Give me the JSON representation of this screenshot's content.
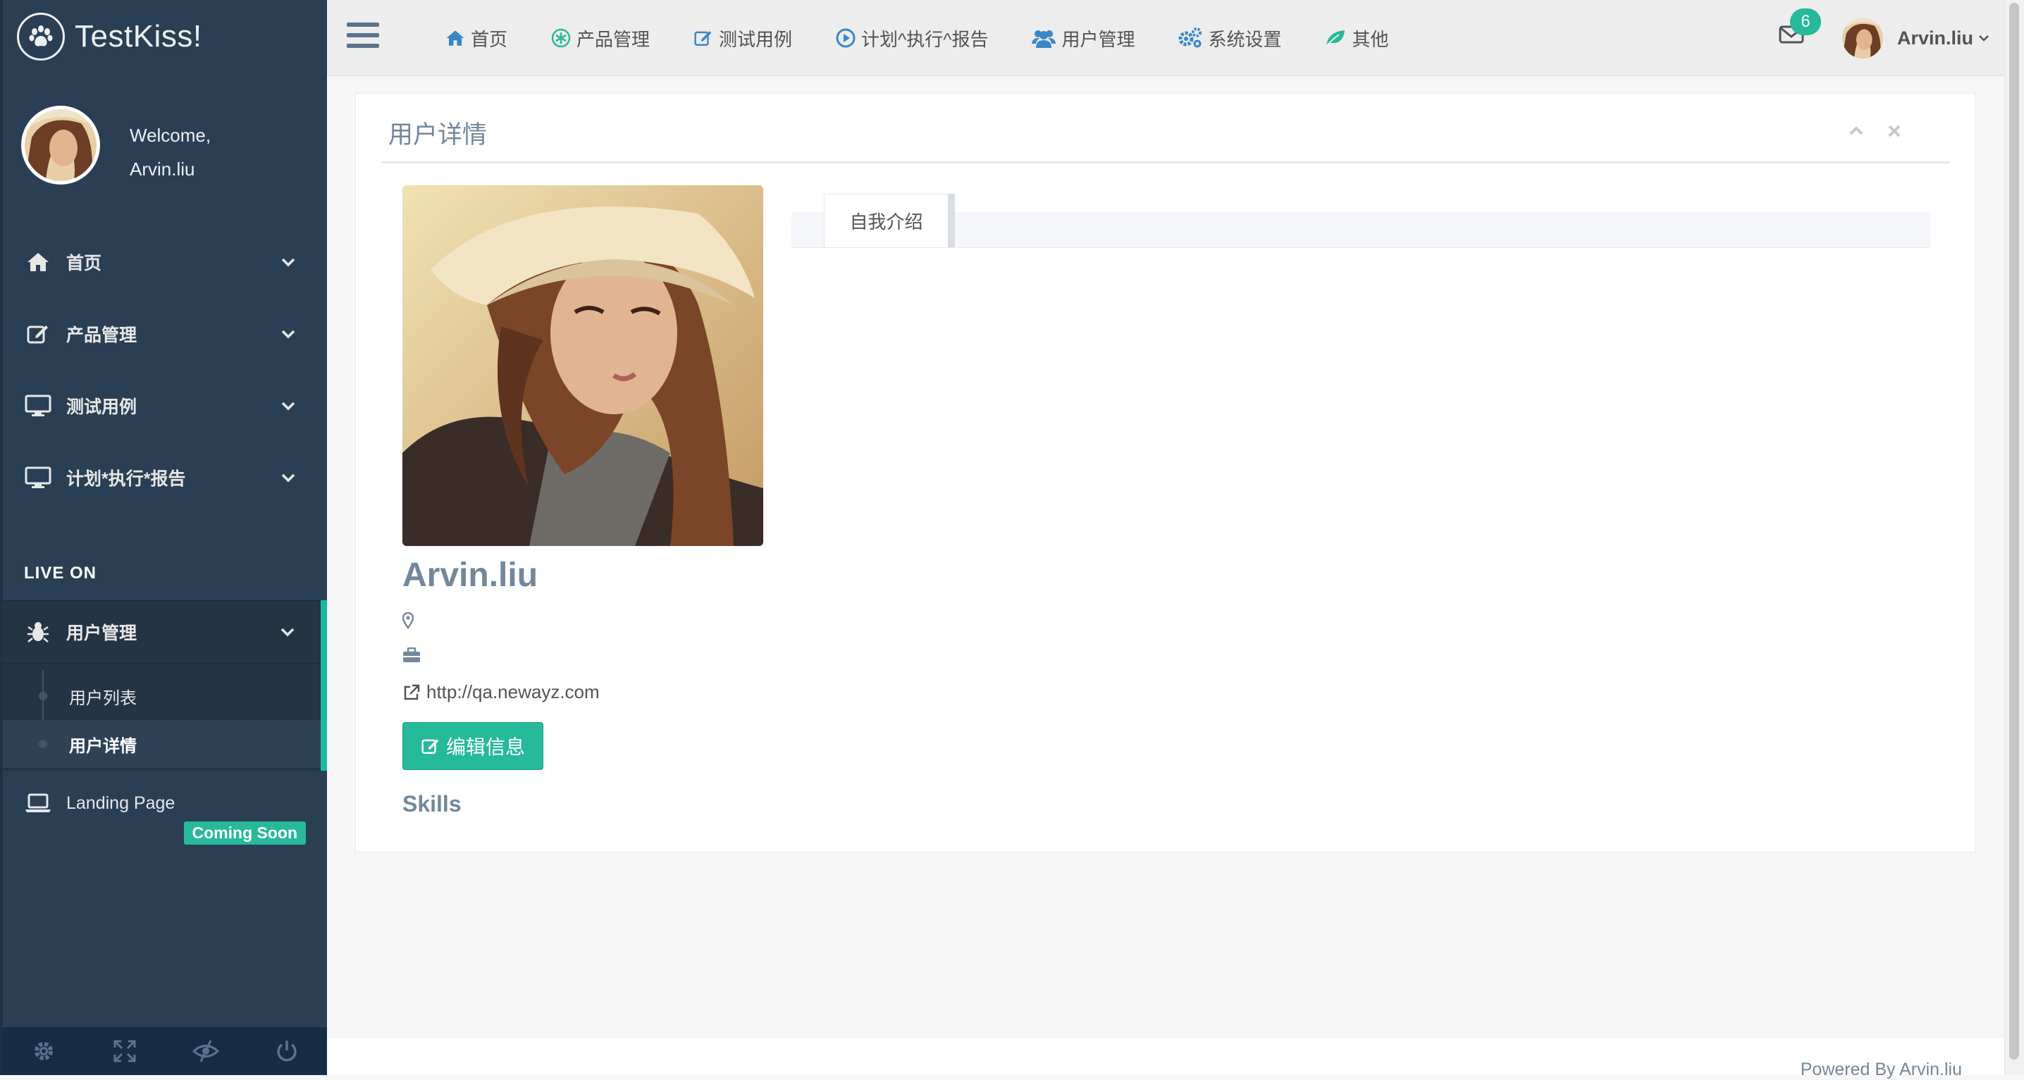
{
  "brand": {
    "name": "TestKiss!"
  },
  "sidebar": {
    "welcome": "Welcome,",
    "username": "Arvin.liu",
    "menu": [
      {
        "label": "首页",
        "icon": "home-icon"
      },
      {
        "label": "产品管理",
        "icon": "edit-icon"
      },
      {
        "label": "测试用例",
        "icon": "desktop-icon"
      },
      {
        "label": "计划*执行*报告",
        "icon": "desktop-icon"
      }
    ],
    "section_title": "LIVE ON",
    "active_group": {
      "label": "用户管理",
      "icon": "bug-icon",
      "items": [
        {
          "label": "用户列表",
          "current": false
        },
        {
          "label": "用户详情",
          "current": true
        }
      ]
    },
    "landing": {
      "label": "Landing Page",
      "badge": "Coming Soon"
    },
    "footer_icons": [
      "settings-icon",
      "fullscreen-icon",
      "eye-slash-icon",
      "power-icon"
    ]
  },
  "topbar": {
    "nav": [
      {
        "label": "首页",
        "icon": "home-icon"
      },
      {
        "label": "产品管理",
        "icon": "asterisk-icon"
      },
      {
        "label": "测试用例",
        "icon": "edit-icon"
      },
      {
        "label": "计划^执行^报告",
        "icon": "play-circle-icon"
      },
      {
        "label": "用户管理",
        "icon": "users-icon"
      },
      {
        "label": "系统设置",
        "icon": "cogs-icon"
      },
      {
        "label": "其他",
        "icon": "leaf-icon"
      }
    ],
    "mail_count": "6",
    "user": "Arvin.liu"
  },
  "panel": {
    "title": "用户详情",
    "name": "Arvin.liu",
    "location": "",
    "job": "",
    "website": "http://qa.newayz.com",
    "edit_button": "编辑信息",
    "skills_title": "Skills",
    "tabs": [
      {
        "label": "自我介绍",
        "active": true
      }
    ]
  },
  "footer": {
    "powered": "Powered By Arvin.liu"
  },
  "colors": {
    "sidebar": "#2a3f54",
    "accent": "#26b99a",
    "text": "#73879c"
  }
}
